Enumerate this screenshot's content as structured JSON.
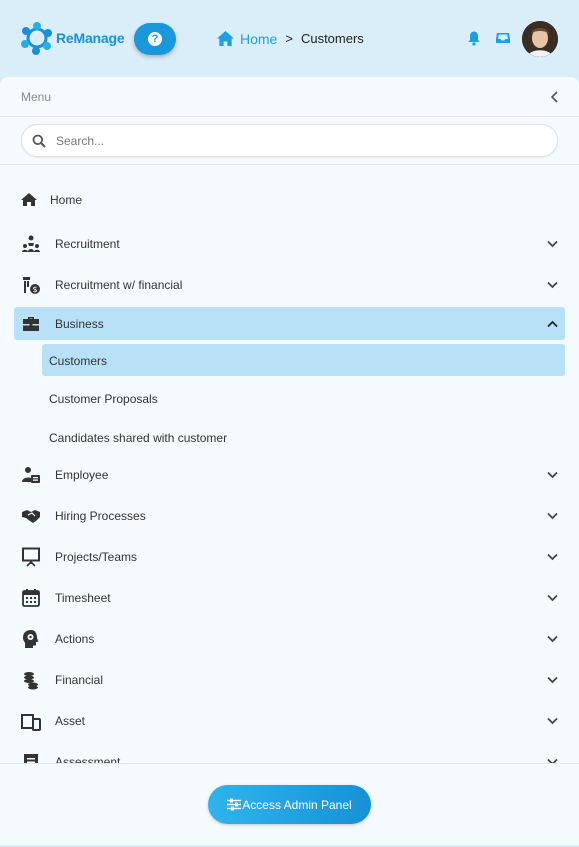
{
  "header": {
    "logo_text": "ReManage",
    "help_glyph": "?",
    "breadcrumb": {
      "home": "Home",
      "separator": ">",
      "current": "Customers"
    },
    "icons": [
      "bell-icon",
      "inbox-icon",
      "user-avatar"
    ]
  },
  "sidebar": {
    "title": "Menu",
    "search_placeholder": "Search...",
    "items": [
      {
        "label": "Home",
        "icon": "home-icon",
        "has_children": false
      },
      {
        "label": "Recruitment",
        "icon": "recruitment-icon",
        "has_children": true
      },
      {
        "label": "Recruitment w/ financial",
        "icon": "recruitment-financial-icon",
        "has_children": true
      },
      {
        "label": "Business",
        "icon": "briefcase-icon",
        "has_children": true,
        "expanded": true,
        "children": [
          {
            "label": "Customers",
            "active": true
          },
          {
            "label": "Customer Proposals"
          },
          {
            "label": "Candidates shared with customer"
          }
        ]
      },
      {
        "label": "Employee",
        "icon": "employee-icon",
        "has_children": true
      },
      {
        "label": "Hiring Processes",
        "icon": "handshake-icon",
        "has_children": true
      },
      {
        "label": "Projects/Teams",
        "icon": "presentation-icon",
        "has_children": true
      },
      {
        "label": "Timesheet",
        "icon": "calendar-icon",
        "has_children": true
      },
      {
        "label": "Actions",
        "icon": "head-gear-icon",
        "has_children": true
      },
      {
        "label": "Financial",
        "icon": "coins-icon",
        "has_children": true
      },
      {
        "label": "Asset",
        "icon": "devices-icon",
        "has_children": true
      },
      {
        "label": "Assessment",
        "icon": "assessment-icon",
        "has_children": true
      }
    ]
  },
  "footer": {
    "admin_button": "Access Admin Panel"
  },
  "colors": {
    "accent": "#1998dc",
    "header_bg": "#daeefa",
    "panel_bg": "#f4fafe",
    "active_bg": "#b8e1f8"
  }
}
